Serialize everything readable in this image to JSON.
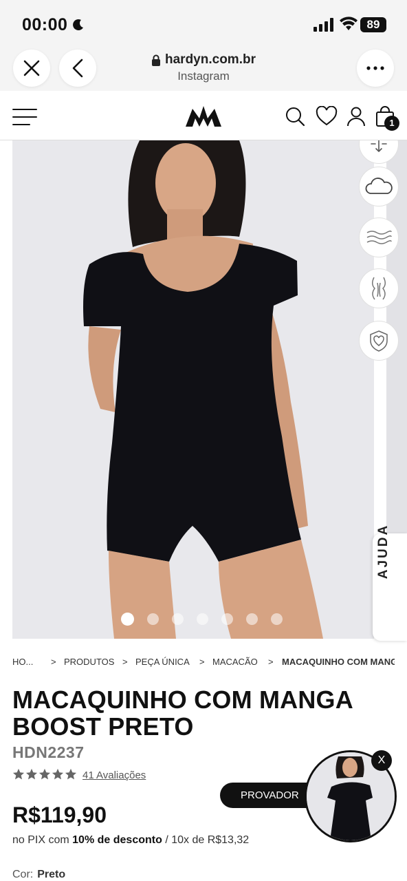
{
  "status_bar": {
    "time": "00:00",
    "battery": "89",
    "icons": [
      "moon-icon",
      "signal-icon",
      "wifi-icon",
      "battery-icon"
    ]
  },
  "browser": {
    "domain": "hardyn.com.br",
    "subtitle": "Instagram",
    "icons": [
      "close-icon",
      "back-icon",
      "lock-icon",
      "more-icon"
    ]
  },
  "site_header": {
    "icons": [
      "menu-icon",
      "brand-logo",
      "search-icon",
      "heart-icon",
      "user-icon",
      "bag-icon"
    ],
    "cart_count": "1"
  },
  "gallery": {
    "slide_count": 7,
    "active_slide": 1,
    "feature_icons": [
      "stretch-icon",
      "cloud-icon",
      "wind-icon",
      "body-shape-icon",
      "shield-heart-icon"
    ]
  },
  "help_tab": {
    "label": "AJUDA"
  },
  "breadcrumb": {
    "home": "HO...",
    "items": [
      "PRODUTOS",
      "PEÇA ÚNICA",
      "MACACÃO",
      "MACAQUINHO COM MANGA"
    ],
    "separator": ">"
  },
  "product": {
    "title": "MACAQUINHO COM MANGA BOOST PRETO",
    "sku": "HDN2237",
    "rating": 5,
    "reviews": "41 Avaliações",
    "price": "R$119,90",
    "pix_prefix": "no PIX com",
    "pix_discount": "10% de desconto",
    "installments": "/ 10x de R$13,32",
    "color_label": "Cor:",
    "color_value": "Preto"
  },
  "try_on": {
    "button_label": "PROVADOR",
    "close_label": "X"
  },
  "colors": {
    "accent": "#111111",
    "background": "#ffffff",
    "gallery_bg": "#e9e9ed"
  }
}
